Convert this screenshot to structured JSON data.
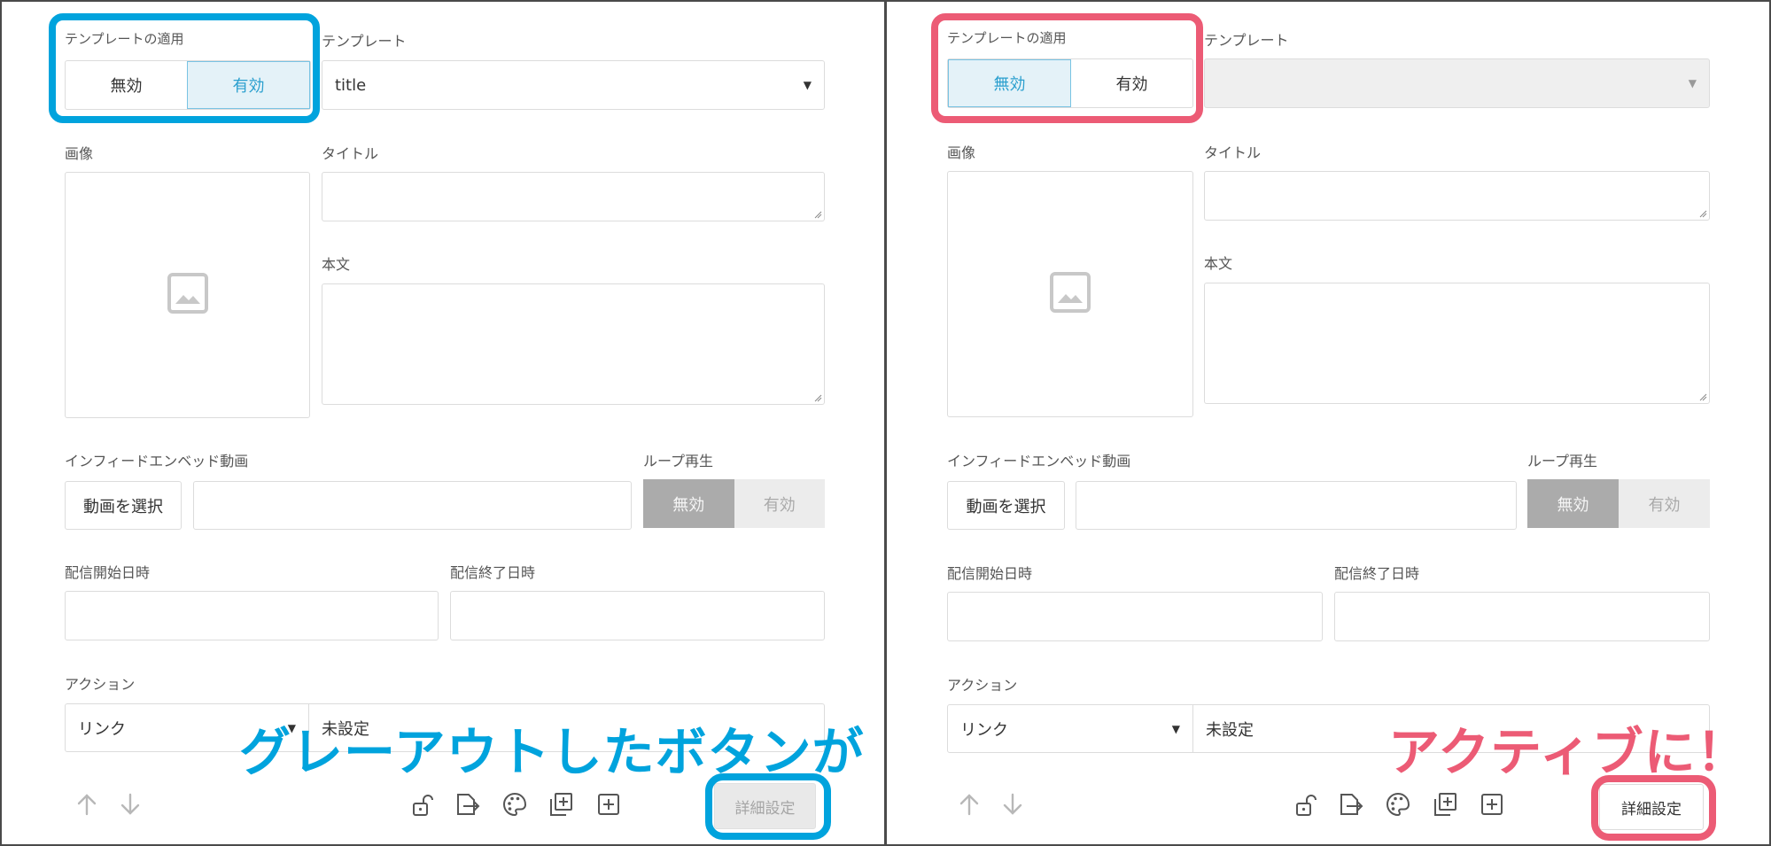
{
  "colors": {
    "blue_highlight": "#00a3dd",
    "pink_highlight": "#ec5b75",
    "toggle_active": "#2a9fce"
  },
  "left": {
    "template_apply_label": "テンプレートの適用",
    "template_apply_options": [
      "無効",
      "有効"
    ],
    "template_apply_selected": "有効",
    "template_label": "テンプレート",
    "template_value": "title",
    "image_label": "画像",
    "title_label": "タイトル",
    "body_label": "本文",
    "infeed_label": "インフィードエンベッド動画",
    "select_video_button": "動画を選択",
    "loop_label": "ループ再生",
    "loop_options": [
      "無効",
      "有効"
    ],
    "start_label": "配信開始日時",
    "end_label": "配信終了日時",
    "action_label": "アクション",
    "action_type": "リンク",
    "action_value": "未設定",
    "details_button": "詳細設定",
    "caption": "グレーアウトしたボタンが"
  },
  "right": {
    "template_apply_label": "テンプレートの適用",
    "template_apply_options": [
      "無効",
      "有効"
    ],
    "template_apply_selected": "無効",
    "template_label": "テンプレート",
    "template_value": "",
    "image_label": "画像",
    "title_label": "タイトル",
    "body_label": "本文",
    "infeed_label": "インフィードエンベッド動画",
    "select_video_button": "動画を選択",
    "loop_label": "ループ再生",
    "loop_options": [
      "無効",
      "有効"
    ],
    "start_label": "配信開始日時",
    "end_label": "配信終了日時",
    "action_label": "アクション",
    "action_type": "リンク",
    "action_value": "未設定",
    "details_button": "詳細設定",
    "caption": "アクティブに！"
  },
  "icons": [
    "arrow-up-icon",
    "arrow-down-icon",
    "unlock-icon",
    "transfer-icon",
    "palette-icon",
    "duplicate-icon",
    "add-icon"
  ]
}
